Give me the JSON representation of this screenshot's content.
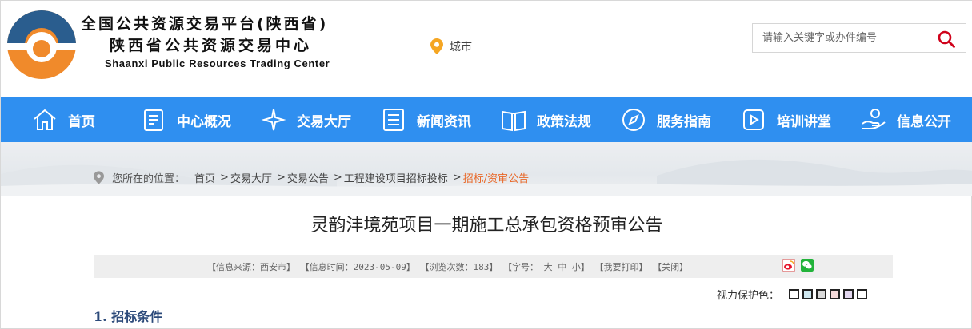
{
  "header": {
    "title_line1": "全国公共资源交易平台(陕西省)",
    "title_line2": "陕西省公共资源交易中心",
    "title_line3": "Shaanxi Public Resources Trading Center",
    "city_label": "城市",
    "search_placeholder": "请输入关键字或办件编号",
    "colors": {
      "logo_orange": "#f08a2b",
      "logo_blue": "#2a5d8e",
      "accent": "#e8692a"
    }
  },
  "nav": {
    "color": "#2f8ff0",
    "items": [
      {
        "label": "首页",
        "icon": "home-icon"
      },
      {
        "label": "中心概况",
        "icon": "document-icon"
      },
      {
        "label": "交易大厅",
        "icon": "sparkle-icon"
      },
      {
        "label": "新闻资讯",
        "icon": "news-icon"
      },
      {
        "label": "政策法规",
        "icon": "book-icon"
      },
      {
        "label": "服务指南",
        "icon": "compass-icon"
      },
      {
        "label": "培训讲堂",
        "icon": "video-icon"
      },
      {
        "label": "信息公开",
        "icon": "hand-icon"
      }
    ]
  },
  "breadcrumb": {
    "prefix": "您所在的位置：",
    "items": [
      "首页",
      "交易大厅",
      "交易公告",
      "工程建设项目招标投标"
    ],
    "separator": ">",
    "current": "招标/资审公告"
  },
  "article": {
    "title": "灵韵沣境苑项目一期施工总承包资格预审公告",
    "source": "【信息来源：西安市】",
    "time": "【信息时间：2023-05-09】",
    "views": "【浏览次数：183】",
    "font_label": "【字号：",
    "font_large": "大",
    "font_medium": "中",
    "font_small": "小】",
    "print": "【我要打印】",
    "close": "【关闭】",
    "eye_protect_label": "视力保护色：",
    "eye_colors": [
      "#ffffff",
      "#cfe8f0",
      "#d9d9d9",
      "#f4d9d9",
      "#e3d7ef",
      "#ffffff"
    ],
    "section_heading": "1. 招标条件"
  }
}
